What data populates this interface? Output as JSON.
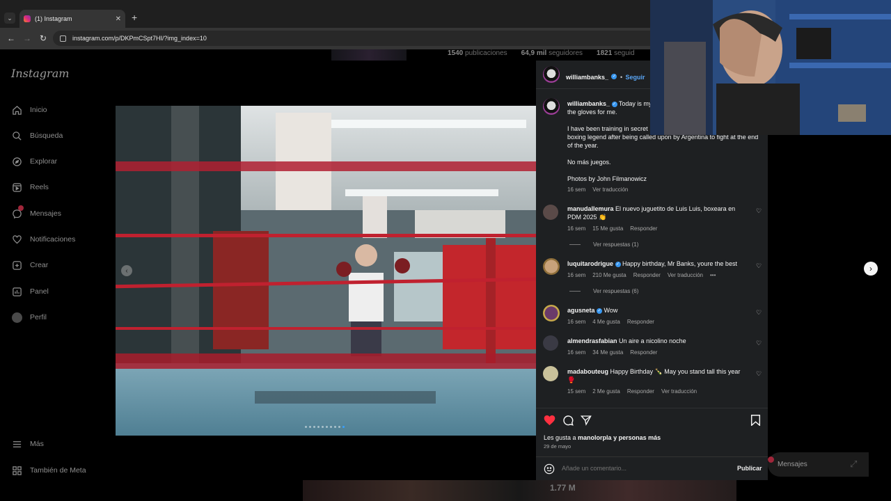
{
  "browser": {
    "tab_title": "(1) Instagram",
    "url": "instagram.com/p/DKPmCSpt7HI/?img_index=10",
    "new_tab_symbol": "+",
    "close_symbol": "✕"
  },
  "background_profile": {
    "posts": "1540",
    "posts_label": "publicaciones",
    "followers": "64,9 mil",
    "followers_label": "seguidores",
    "following": "1821",
    "following_label": "seguid"
  },
  "sidebar": {
    "logo": "Instagram",
    "items": [
      {
        "label": "Inicio",
        "icon": "home-icon"
      },
      {
        "label": "Búsqueda",
        "icon": "search-icon"
      },
      {
        "label": "Explorar",
        "icon": "compass-icon"
      },
      {
        "label": "Reels",
        "icon": "reels-icon"
      },
      {
        "label": "Mensajes",
        "icon": "messenger-icon"
      },
      {
        "label": "Notificaciones",
        "icon": "heart-icon"
      },
      {
        "label": "Crear",
        "icon": "plus-square-icon"
      },
      {
        "label": "Panel",
        "icon": "bar-chart-icon"
      },
      {
        "label": "Perfil",
        "icon": "profile-icon"
      },
      {
        "label": "Más",
        "icon": "menu-icon"
      },
      {
        "label": "También de Meta",
        "icon": "meta-icon"
      }
    ]
  },
  "post": {
    "carousel_dots": 10,
    "active_dot": 10,
    "author": "williambanks_",
    "follow_label": "Seguir",
    "separator": "•",
    "caption_lines": [
      "Today is my [...] the gloves for me.",
      "I have been training in secret [...] boxing legend after being called upon by Argentina to fight at the end of the year.",
      "No más juegos.",
      "Photos by John Filmanowicz"
    ],
    "caption_first": "Today is my",
    "caption_first_cont": "the gloves for me.",
    "caption_second_a": "I have been training in secret",
    "caption_second_b": "boxing legend after being called upon by Argentina to fight at the end of the year.",
    "caption_third": "No más juegos.",
    "caption_fourth": "Photos by John Filmanowicz",
    "caption_time": "16 sem",
    "caption_translate": "Ver traducción"
  },
  "comments": [
    {
      "user": "manudallemura",
      "verified": false,
      "text": "El nuevo juguetito de Luis Luis, boxeara en PDM 2025 👏",
      "time": "16 sem",
      "likes": "15 Me gusta",
      "reply": "Responder",
      "translate": "",
      "more": "",
      "view_replies": "Ver respuestas (1)"
    },
    {
      "user": "luquitarodrigue",
      "verified": true,
      "text": "Happy birthday, Mr Banks, youre the best",
      "time": "16 sem",
      "likes": "210 Me gusta",
      "reply": "Responder",
      "translate": "Ver traducción",
      "more": "•••",
      "view_replies": "Ver respuestas (6)"
    },
    {
      "user": "agusneta",
      "verified": true,
      "text": "Wow",
      "time": "16 sem",
      "likes": "4 Me gusta",
      "reply": "Responder",
      "translate": "",
      "more": "",
      "view_replies": ""
    },
    {
      "user": "almendrasfabian",
      "verified": false,
      "text": "Un aire a nicolino noche",
      "time": "16 sem",
      "likes": "34 Me gusta",
      "reply": "Responder",
      "translate": "",
      "more": "",
      "view_replies": ""
    },
    {
      "user": "madabouteug",
      "verified": false,
      "text": "Happy Birthday 🍾 May you stand tall this year 🥊",
      "time": "15 sem",
      "likes": "2 Me gusta",
      "reply": "Responder",
      "translate": "Ver traducción",
      "more": "",
      "view_replies": ""
    }
  ],
  "actions": {
    "likes_prefix": "Les gusta a ",
    "likes_user": "manolorpla",
    "likes_suffix": " y personas más",
    "date": "29 de mayo",
    "comment_placeholder": "Añade un comentario...",
    "publish": "Publicar"
  },
  "messages_pill": {
    "label": "Mensajes"
  },
  "bottom_strip": {
    "count": "1.77 M"
  },
  "colors": {
    "like_red": "#ff3040",
    "link_blue": "#5aa6f5",
    "verified_blue": "#3897f0",
    "notification_red": "#a0263a"
  }
}
